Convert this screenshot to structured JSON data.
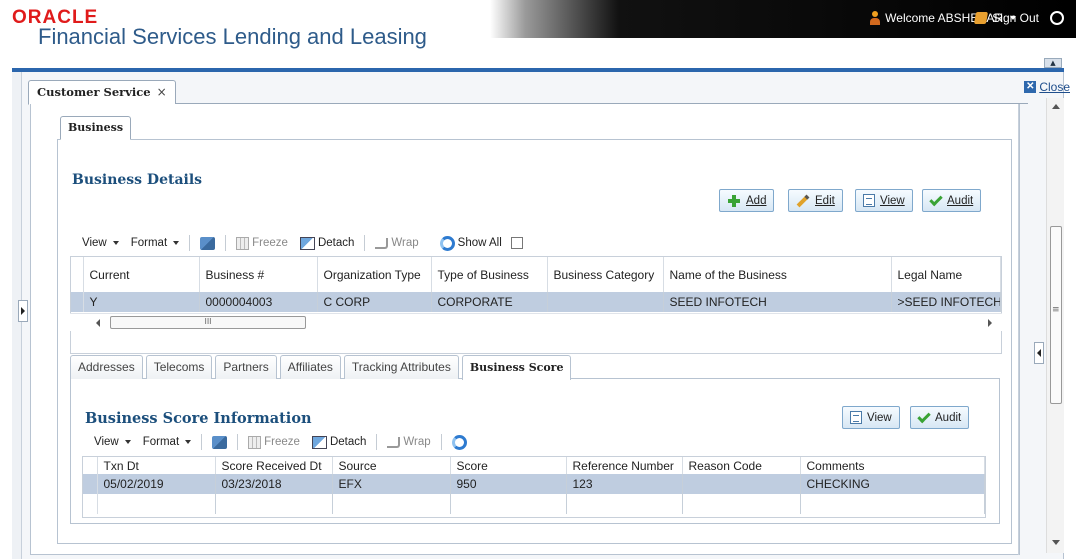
{
  "header": {
    "logo": "ORACLE",
    "product": "Financial Services Lending and Leasing",
    "welcome": "Welcome ABSHEKAR",
    "sign_out": "Sign Out"
  },
  "doc_tab": {
    "label": "Customer Service",
    "close_x": "×"
  },
  "close_link": "Close",
  "business_tab": "Business",
  "business_details": {
    "title": "Business Details",
    "buttons": {
      "add": "Add",
      "edit": "Edit",
      "view": "View",
      "audit": "Audit"
    },
    "toolbar": {
      "view": "View",
      "format": "Format",
      "freeze": "Freeze",
      "detach": "Detach",
      "wrap": "Wrap",
      "show_all": "Show All"
    },
    "columns": [
      "Current",
      "Business #",
      "Organization Type",
      "Type of Business",
      "Business Category",
      "Name of the Business",
      "Legal Name"
    ],
    "rows": [
      [
        "Y",
        "0000004003",
        "C CORP",
        "CORPORATE",
        "",
        "SEED INFOTECH",
        ">SEED INFOTECH"
      ]
    ],
    "scroll_thumb": "III"
  },
  "sub_tabs": [
    "Addresses",
    "Telecoms",
    "Partners",
    "Affiliates",
    "Tracking Attributes",
    "Business Score"
  ],
  "active_sub_tab": "Business Score",
  "business_score": {
    "title": "Business Score Information",
    "buttons": {
      "view": "View",
      "audit": "Audit"
    },
    "toolbar": {
      "view": "View",
      "format": "Format",
      "freeze": "Freeze",
      "detach": "Detach",
      "wrap": "Wrap"
    },
    "columns": [
      "Txn Dt",
      "Score Received Dt",
      "Source",
      "Score",
      "Reference Number",
      "Reason Code",
      "Comments"
    ],
    "rows": [
      [
        "05/02/2019",
        "03/23/2018",
        "EFX",
        "950",
        "123",
        "",
        "CHECKING"
      ]
    ]
  }
}
